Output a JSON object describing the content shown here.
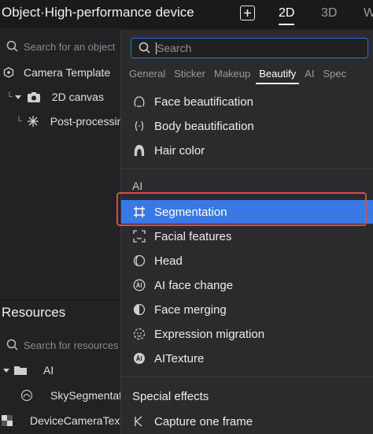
{
  "header": {
    "title": "Object·High-performance device",
    "add_icon": "plus-square-icon",
    "view_tabs": [
      {
        "label": "2D",
        "active": true
      },
      {
        "label": "3D",
        "active": false
      },
      {
        "label": "W",
        "active": false
      }
    ]
  },
  "hierarchy": {
    "search_placeholder": "Search for an object",
    "items": [
      {
        "label": "Camera Template",
        "icon": "camera-template-icon"
      },
      {
        "label": "2D canvas",
        "icon": "camera-icon"
      },
      {
        "label": "Post-processing",
        "icon": "sparkle-icon"
      }
    ]
  },
  "resources": {
    "title": "Resources",
    "search_placeholder": "Search for resources",
    "items": [
      {
        "label": "AI",
        "icon": "folder-icon"
      },
      {
        "label": "SkySegmentation",
        "icon": "segmentation-res-icon"
      },
      {
        "label": "DeviceCameraTexture",
        "icon": "checker-icon"
      }
    ]
  },
  "menu": {
    "search_placeholder": "Search",
    "tabs": [
      {
        "label": "General",
        "active": false
      },
      {
        "label": "Sticker",
        "active": false
      },
      {
        "label": "Makeup",
        "active": false
      },
      {
        "label": "Beautify",
        "active": true
      },
      {
        "label": "AI",
        "active": false
      },
      {
        "label": "Spec",
        "active": false
      }
    ],
    "beautify_items": [
      {
        "label": "Face beautification",
        "icon": "face-icon"
      },
      {
        "label": "Body beautification",
        "icon": "body-icon"
      },
      {
        "label": "Hair color",
        "icon": "hair-icon"
      }
    ],
    "ai_section_label": "AI",
    "ai_items": [
      {
        "label": "Segmentation",
        "icon": "crop-icon",
        "selected": true
      },
      {
        "label": "Facial features",
        "icon": "face-scan-icon",
        "selected": false
      },
      {
        "label": "Head",
        "icon": "head-icon",
        "selected": false
      },
      {
        "label": "AI face change",
        "icon": "ai-badge-icon",
        "selected": false
      },
      {
        "label": "Face merging",
        "icon": "face-merge-icon",
        "selected": false
      },
      {
        "label": "Expression migration",
        "icon": "expression-icon",
        "selected": false
      },
      {
        "label": "AITexture",
        "icon": "ai-texture-icon",
        "selected": false
      }
    ],
    "effects_section_label": "Special effects",
    "effects_items": [
      {
        "label": "Capture one frame",
        "icon": "capture-icon"
      }
    ]
  },
  "colors": {
    "selected_bg": "#3a78e6",
    "highlight_border": "#e04b3c",
    "search_border": "#2f6fd6"
  }
}
